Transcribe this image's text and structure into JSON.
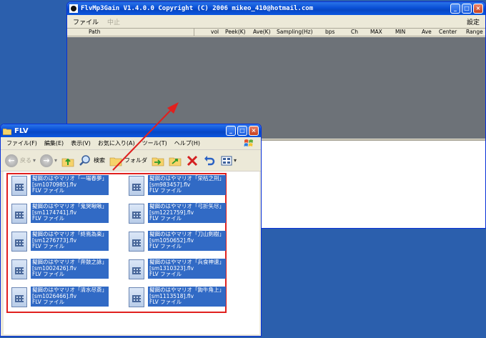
{
  "mp3gain": {
    "title": "FlvMp3Gain V1.4.0.0  Copyright (C) 2006 mikeo_410@hotmail.com",
    "menu": {
      "file": "ファイル",
      "stop": "中止",
      "settings": "設定"
    },
    "columns": [
      "Path",
      "vol",
      "Peek(K)",
      "Ave(K)",
      "Sampling(Hz)",
      "bps",
      "Ch",
      "MAX",
      "MIN",
      "Ave",
      "Center",
      "Range"
    ]
  },
  "explorer": {
    "title": "FLV",
    "menu": [
      "ファイル(F)",
      "編集(E)",
      "表示(V)",
      "お気に入り(A)",
      "ツール(T)",
      "ヘルプ(H)"
    ],
    "toolbar": {
      "back": "戻る",
      "search": "検索",
      "folder": "フォルダ"
    },
    "files": [
      {
        "name": "擬餌のはやマリオ「一場春夢」",
        "id": "[sm1070985].flv",
        "type": "FLV ファイル"
      },
      {
        "name": "擬餌のはやマリオ「栄枯之刑」",
        "id": "[sm983457].flv",
        "type": "FLV ファイル"
      },
      {
        "name": "擬餌のはやマリオ「鬼哭啾啾」",
        "id": "[sm1174741].flv",
        "type": "FLV ファイル"
      },
      {
        "name": "擬餌のはやマリオ「弓折矢尽」",
        "id": "[sm1221759].flv",
        "type": "FLV ファイル"
      },
      {
        "name": "擬餌のはやマリオ「終焉為楽」",
        "id": "[sm1276773].flv",
        "type": "FLV ファイル"
      },
      {
        "name": "擬餌のはやマリオ「刀山剣樹」",
        "id": "[sm1050652].flv",
        "type": "FLV ファイル"
      },
      {
        "name": "擬餌のはやマリオ「奔鼓之詠」",
        "id": "[sm1002426].flv",
        "type": "FLV ファイル"
      },
      {
        "name": "擬餌のはやマリオ「兵食神速」",
        "id": "[sm1310323].flv",
        "type": "FLV ファイル"
      },
      {
        "name": "擬餌のはやマリオ「清水尽斎」",
        "id": "[sm1026466].flv",
        "type": "FLV ファイル"
      },
      {
        "name": "擬餌のはやマリオ「鉤牛角上」",
        "id": "[sm1113518].flv",
        "type": "FLV ファイル"
      }
    ]
  },
  "colors": {
    "highlight": "#316ac5",
    "redbox": "#e0201e",
    "list_bg": "#6d7278",
    "desktop": "#2b5fad"
  }
}
